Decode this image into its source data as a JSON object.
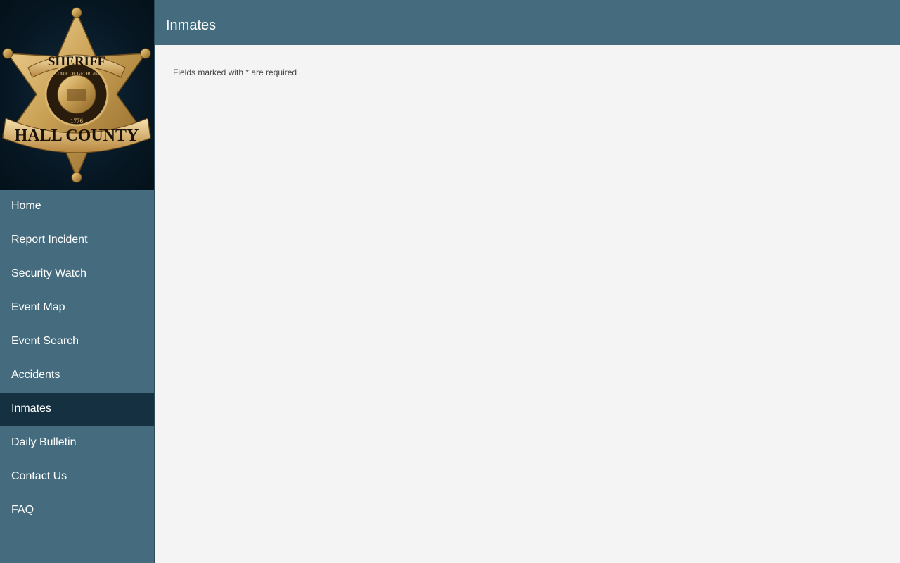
{
  "header": {
    "title": "Inmates"
  },
  "logo": {
    "text_top": "SHERIFF",
    "text_ring": "STATE OF GEORGIA",
    "text_year": "1776",
    "text_bottom": "HALL COUNTY",
    "icon": "sheriff-badge-logo"
  },
  "sidebar": {
    "items": [
      {
        "label": "Home",
        "active": false
      },
      {
        "label": "Report Incident",
        "active": false
      },
      {
        "label": "Security Watch",
        "active": false
      },
      {
        "label": "Event Map",
        "active": false
      },
      {
        "label": "Event Search",
        "active": false
      },
      {
        "label": "Accidents",
        "active": false
      },
      {
        "label": "Inmates",
        "active": true
      },
      {
        "label": "Daily Bulletin",
        "active": false
      },
      {
        "label": "Contact Us",
        "active": false
      },
      {
        "label": "FAQ",
        "active": false
      }
    ]
  },
  "main": {
    "required_note": "Fields marked with * are required"
  },
  "colors": {
    "sidebar_bg": "#456c7e",
    "active_item_bg": "#143041",
    "header_bg": "#456c7e",
    "content_bg": "#f4f4f4",
    "badge_gold": "#c9a054"
  }
}
